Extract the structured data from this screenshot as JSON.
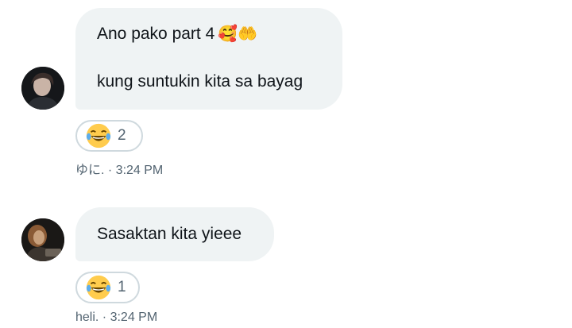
{
  "messages": [
    {
      "lines": [
        "Ano pako part 4",
        "kung suntukin kita sa bayag"
      ],
      "line1_emojis": "🥰🤲",
      "reaction": {
        "emoji": "😂",
        "count": "2"
      },
      "sender": "ゆに.",
      "time": "3:24 PM",
      "separator": " · "
    },
    {
      "lines": [
        "Sasaktan kita yieee"
      ],
      "reaction": {
        "emoji": "😂",
        "count": "1"
      },
      "sender": "heli.",
      "time": "3:24 PM",
      "separator": " · "
    }
  ],
  "colors": {
    "bubble": "#eff3f4",
    "text": "#0f1419",
    "secondary": "#536471",
    "reaction_border": "#cfd9de"
  }
}
